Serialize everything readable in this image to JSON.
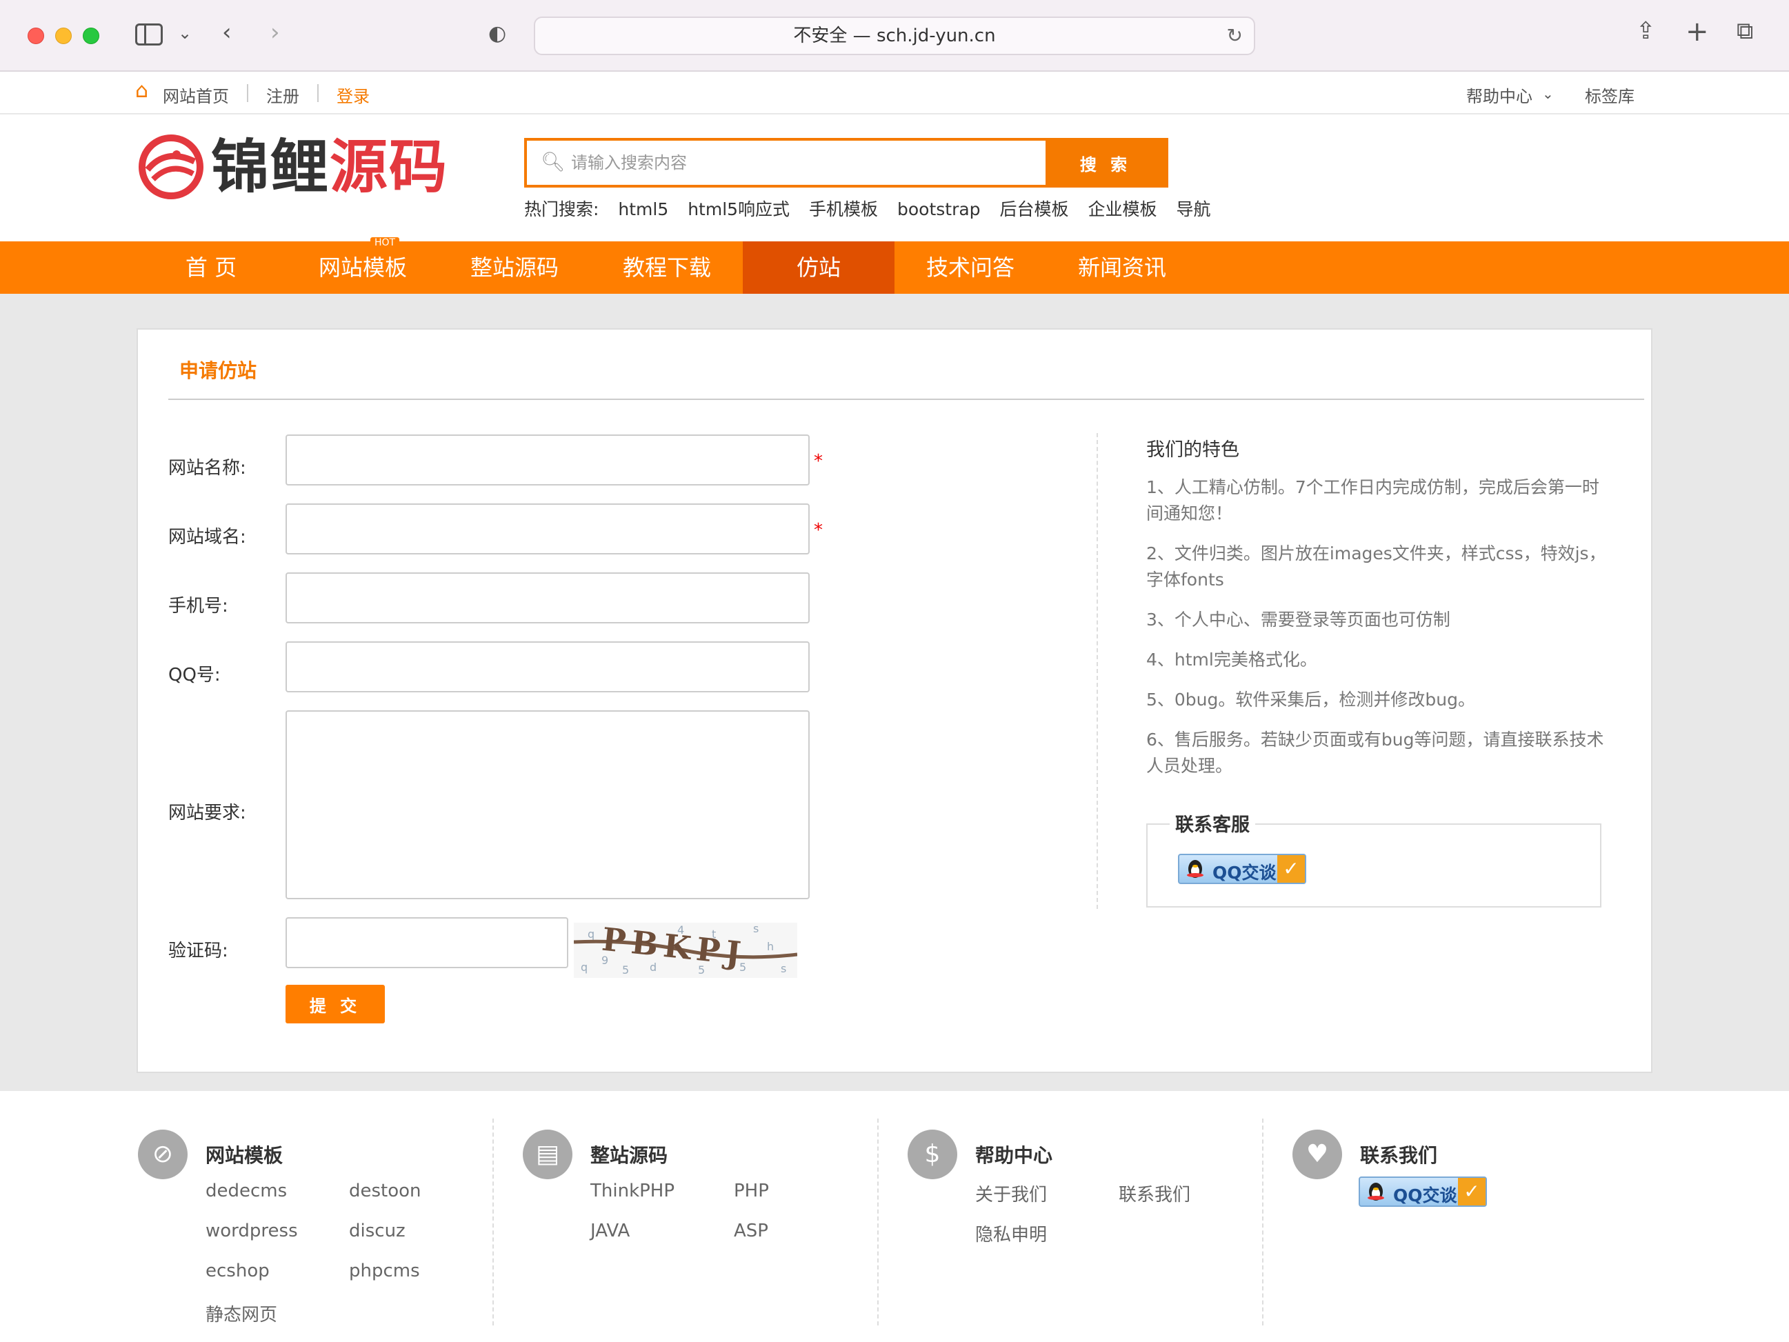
{
  "browser": {
    "url_text": "不安全 — sch.jd-yun.cn"
  },
  "topbar": {
    "home": "网站首页",
    "register": "注册",
    "login": "登录",
    "help": "帮助中心",
    "tags": "标签库"
  },
  "header": {
    "logo_dark": "锦鲤",
    "logo_red": "源码",
    "search_placeholder": "请输入搜索内容",
    "search_button": "搜 索",
    "hot_label": "热门搜索:",
    "hot_terms": [
      "html5",
      "html5响应式",
      "手机模板",
      "bootstrap",
      "后台模板",
      "企业模板",
      "导航"
    ]
  },
  "nav": {
    "hot_badge": "HOT",
    "items": [
      "首 页",
      "网站模板",
      "整站源码",
      "教程下载",
      "仿站",
      "技术问答",
      "新闻资讯"
    ],
    "active": "仿站"
  },
  "form": {
    "title": "申请仿站",
    "site_name_label": "网站名称:",
    "domain_label": "网站域名:",
    "phone_label": "手机号:",
    "qq_label": "QQ号:",
    "requirements_label": "网站要求:",
    "captcha_label": "验证码:",
    "required_mark": "*",
    "captcha_text": "PBKPJ",
    "submit_label": "提 交"
  },
  "features": {
    "title": "我们的特色",
    "items": [
      "1、人工精心仿制。7个工作日内完成仿制，完成后会第一时间通知您！",
      "2、文件归类。图片放在images文件夹，样式css，特效js，字体fonts",
      "3、个人中心、需要登录等页面也可仿制",
      "4、html完美格式化。",
      "5、0bug。软件采集后，检测并修改bug。",
      "6、售后服务。若缺少页面或有bug等问题，请直接联系技术人员处理。"
    ],
    "service_title": "联系客服",
    "qq_button": "QQ交谈"
  },
  "footer": {
    "templates": {
      "title": "网站模板",
      "links": [
        "dedecms",
        "destoon",
        "wordpress",
        "discuz",
        "ecshop",
        "phpcms",
        "静态网页"
      ]
    },
    "source": {
      "title": "整站源码",
      "links": [
        "ThinkPHP",
        "PHP",
        "JAVA",
        "ASP"
      ]
    },
    "help": {
      "title": "帮助中心",
      "links": [
        "关于我们",
        "联系我们",
        "隐私申明"
      ]
    },
    "contact": {
      "title": "联系我们",
      "qq_button": "QQ交谈"
    }
  },
  "colors": {
    "accent": "#ff7e00",
    "nav_active": "#e05000",
    "logo_red": "#e3383e"
  }
}
